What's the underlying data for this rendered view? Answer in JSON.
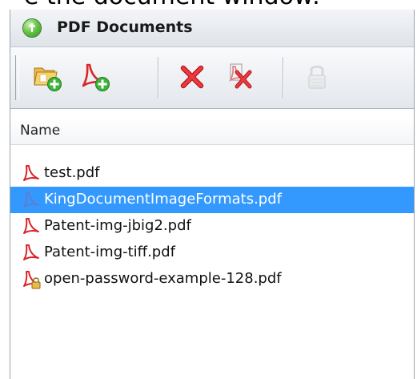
{
  "caption_fragment": "e the document window:",
  "panel": {
    "title": "PDF Documents",
    "header_icon": "green-circle-icon"
  },
  "toolbar": {
    "buttons": [
      {
        "name": "add-folder",
        "icon": "folder-add-icon",
        "enabled": true
      },
      {
        "name": "add-pdf",
        "icon": "pdf-add-icon",
        "enabled": true
      },
      {
        "name": "remove",
        "icon": "red-x-icon",
        "enabled": true
      },
      {
        "name": "remove-all",
        "icon": "pdf-remove-icon",
        "enabled": true
      },
      {
        "name": "unlock",
        "icon": "lock-icon",
        "enabled": false
      }
    ]
  },
  "list": {
    "column_header": "Name",
    "items": [
      {
        "name": "test.pdf",
        "selected": false,
        "locked": false
      },
      {
        "name": "KingDocumentImageFormats.pdf",
        "selected": true,
        "locked": false
      },
      {
        "name": "Patent-img-jbig2.pdf",
        "selected": false,
        "locked": false
      },
      {
        "name": "Patent-img-tiff.pdf",
        "selected": false,
        "locked": false
      },
      {
        "name": "open-password-example-128.pdf",
        "selected": false,
        "locked": true
      }
    ]
  },
  "colors": {
    "selection": "#3399ff",
    "pdf_red": "#d8262b",
    "add_green": "#3cb53a"
  }
}
